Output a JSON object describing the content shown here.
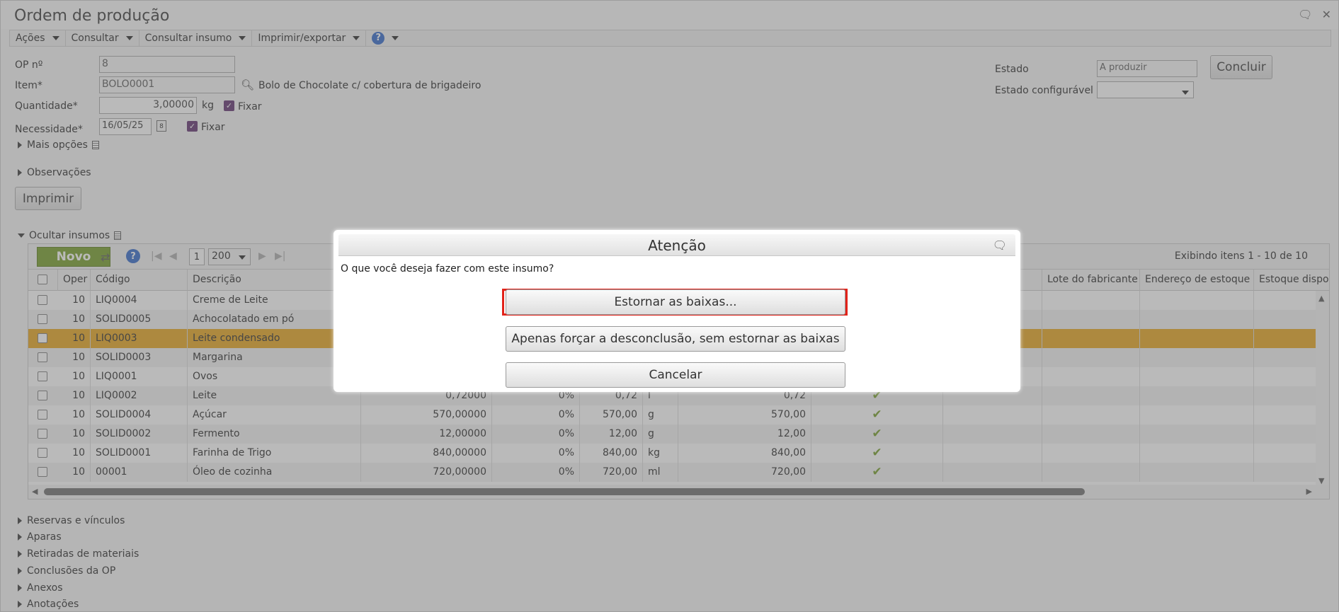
{
  "window": {
    "title": "Ordem de produção",
    "icons": [
      "chat-icon",
      "close-icon"
    ]
  },
  "menu": [
    {
      "label": "Ações"
    },
    {
      "label": "Consultar"
    },
    {
      "label": "Consultar insumo"
    },
    {
      "label": "Imprimir/exportar"
    },
    {
      "label": "?"
    }
  ],
  "form": {
    "op_label": "OP nº",
    "op_value": "8",
    "item_label": "Item*",
    "item_value": "BOLO0001",
    "item_desc": "Bolo de Chocolate c/ cobertura de brigadeiro",
    "qty_label": "Quantidade*",
    "qty_value": "3,00000",
    "qty_unit": "kg",
    "fixar_label": "Fixar",
    "nec_label": "Necessidade*",
    "nec_value": "16/05/25",
    "mais_opcoes": "Mais opções",
    "observacoes": "Observações",
    "imprimir": "Imprimir",
    "estado_label": "Estado",
    "estado_value": "A produzir",
    "estado_conf_label": "Estado configurável",
    "estado_conf_value": "",
    "concluir": "Concluir",
    "ocultar_insumos": "Ocultar insumos"
  },
  "grid": {
    "novo": "Novo",
    "page": "1",
    "page_size": "200",
    "showing": "Exibindo itens 1 - 10 de 10",
    "headers": {
      "oper": "Oper",
      "codigo": "Código",
      "descricao": "Descrição",
      "lote": "Lote do fabricante",
      "endereco": "Endereço de estoque",
      "estoque": "Estoque disponível"
    },
    "rows": [
      {
        "oper": "10",
        "codigo": "LIQ0004",
        "descricao": "Creme de Leite",
        "qtd": "",
        "pct": "",
        "qtd2": "",
        "un": "",
        "total": "",
        "ok": false
      },
      {
        "oper": "10",
        "codigo": "SOLID0005",
        "descricao": "Achocolatado em pó",
        "qtd": "",
        "pct": "",
        "qtd2": "",
        "un": "",
        "total": "",
        "ok": false
      },
      {
        "oper": "10",
        "codigo": "LIQ0003",
        "descricao": "Leite condensado",
        "qtd": "",
        "pct": "",
        "qtd2": "",
        "un": "",
        "total": "",
        "ok": false
      },
      {
        "oper": "10",
        "codigo": "SOLID0003",
        "descricao": "Margarina",
        "qtd": "",
        "pct": "",
        "qtd2": "",
        "un": "",
        "total": "",
        "ok": false
      },
      {
        "oper": "10",
        "codigo": "LIQ0001",
        "descricao": "Ovos",
        "qtd": "",
        "pct": "",
        "qtd2": "",
        "un": "",
        "total": "",
        "ok": false
      },
      {
        "oper": "10",
        "codigo": "LIQ0002",
        "descricao": "Leite",
        "qtd": "0,72000",
        "pct": "0%",
        "qtd2": "0,72",
        "un": "l",
        "total": "0,72",
        "ok": true
      },
      {
        "oper": "10",
        "codigo": "SOLID0004",
        "descricao": "Açúcar",
        "qtd": "570,00000",
        "pct": "0%",
        "qtd2": "570,00",
        "un": "g",
        "total": "570,00",
        "ok": true
      },
      {
        "oper": "10",
        "codigo": "SOLID0002",
        "descricao": "Fermento",
        "qtd": "12,00000",
        "pct": "0%",
        "qtd2": "12,00",
        "un": "g",
        "total": "12,00",
        "ok": true
      },
      {
        "oper": "10",
        "codigo": "SOLID0001",
        "descricao": "Farinha de Trigo",
        "qtd": "840,00000",
        "pct": "0%",
        "qtd2": "840,00",
        "un": "kg",
        "total": "840,00",
        "ok": true
      },
      {
        "oper": "10",
        "codigo": "00001",
        "descricao": "Óleo de cozinha",
        "qtd": "720,00000",
        "pct": "0%",
        "qtd2": "720,00",
        "un": "ml",
        "total": "720,00",
        "ok": true
      }
    ]
  },
  "sections": [
    "Reservas e vínculos",
    "Aparas",
    "Retiradas de materiais",
    "Conclusões da OP",
    "Anexos",
    "Anotações"
  ],
  "modal": {
    "title": "Atenção",
    "message": "O que você deseja fazer com este insumo?",
    "btn_estornar": "Estornar as baixas...",
    "btn_forcar": "Apenas forçar a desconclusão, sem estornar as baixas",
    "btn_cancelar": "Cancelar"
  }
}
